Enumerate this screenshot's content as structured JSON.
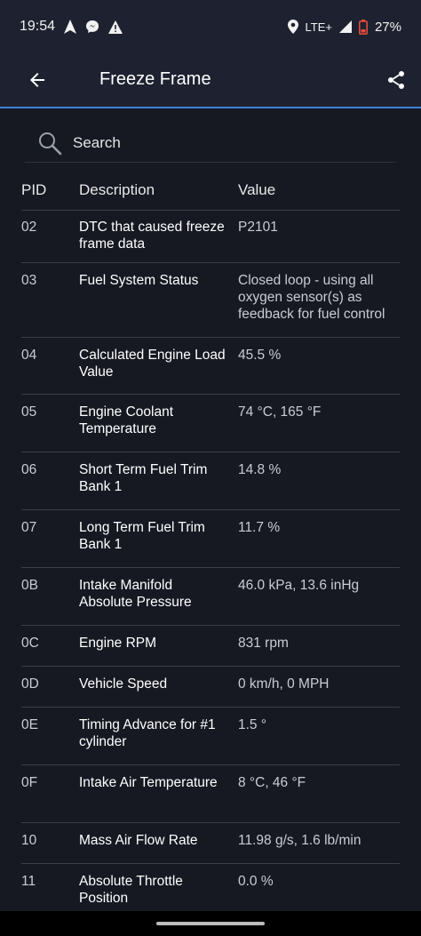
{
  "status_bar": {
    "time": "19:54",
    "network": "LTE+",
    "battery": "27%"
  },
  "app_bar": {
    "title": "Freeze Frame"
  },
  "search": {
    "placeholder": "Search"
  },
  "table": {
    "headers": {
      "pid": "PID",
      "description": "Description",
      "value": "Value"
    },
    "rows": [
      {
        "pid": "02",
        "description": "DTC that caused freeze frame data",
        "value": "P2101"
      },
      {
        "pid": "03",
        "description": "Fuel System Status",
        "value": "Closed loop - using all oxygen sensor(s) as feedback for fuel control"
      },
      {
        "pid": "04",
        "description": "Calculated Engine Load Value",
        "value": "45.5 %"
      },
      {
        "pid": "05",
        "description": "Engine Coolant Temperature",
        "value": "74 °C, 165 °F"
      },
      {
        "pid": "06",
        "description": "Short Term Fuel Trim Bank 1",
        "value": "14.8 %"
      },
      {
        "pid": "07",
        "description": "Long Term Fuel Trim Bank 1",
        "value": "11.7 %"
      },
      {
        "pid": "0B",
        "description": "Intake Manifold Absolute Pressure",
        "value": "46.0 kPa, 13.6 inHg"
      },
      {
        "pid": "0C",
        "description": "Engine RPM",
        "value": "831 rpm"
      },
      {
        "pid": "0D",
        "description": "Vehicle Speed",
        "value": "0 km/h, 0 MPH"
      },
      {
        "pid": "0E",
        "description": "Timing Advance for #1 cylinder",
        "value": "1.5 °"
      },
      {
        "pid": "0F",
        "description": "Intake Air Temperature",
        "value": "8 °C, 46 °F"
      },
      {
        "pid": "10",
        "description": "Mass Air Flow Rate",
        "value": "11.98 g/s, 1.6 lb/min"
      },
      {
        "pid": "11",
        "description": "Absolute Throttle Position",
        "value": "0.0 %"
      }
    ]
  }
}
